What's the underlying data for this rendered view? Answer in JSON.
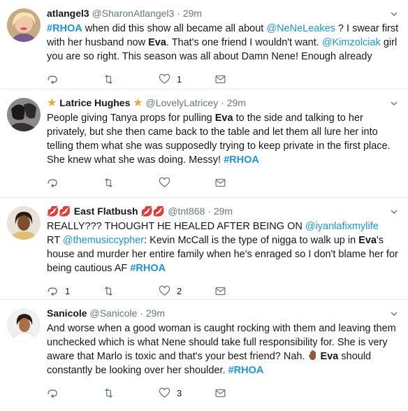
{
  "tweets": [
    {
      "name": "atlangel3",
      "handle": "@SharonAtlangel3",
      "time": "29m",
      "text": [
        {
          "t": "hash",
          "v": "#RHOA"
        },
        {
          "t": "txt",
          "v": " when did this show all became all about "
        },
        {
          "t": "link",
          "v": "@NeNeLeakes"
        },
        {
          "t": "txt",
          "v": " ? I swear first with her husband now "
        },
        {
          "t": "bold",
          "v": "Eva"
        },
        {
          "t": "txt",
          "v": ". That's one friend I wouldn't want. "
        },
        {
          "t": "link",
          "v": "@Kimzolciak"
        },
        {
          "t": "txt",
          "v": " girl you are so right. This season was all about Damn Nene! Enough already"
        }
      ],
      "reply_count": "",
      "retweet_count": "",
      "like_count": "1"
    },
    {
      "name": "Latrice Hughes",
      "handle": "@LovelyLatricey",
      "time": "29m",
      "text": [
        {
          "t": "txt",
          "v": "People giving Tanya props for pulling "
        },
        {
          "t": "bold",
          "v": "Eva"
        },
        {
          "t": "txt",
          "v": " to the side and talking to her privately, but she then came back to the table and let them all lure her into telling them what she was supposedly trying to keep private in the first place.   She knew what she was doing.  Messy! "
        },
        {
          "t": "hash",
          "v": "#RHOA"
        }
      ],
      "reply_count": "",
      "retweet_count": "",
      "like_count": ""
    },
    {
      "name": "East Flatbush",
      "handle": "@tnt868",
      "time": "29m",
      "text": [
        {
          "t": "txt",
          "v": "REALLY??? THOUGHT HE HEALED AFTER BEING ON "
        },
        {
          "t": "link",
          "v": "@iyanlafixmylife"
        },
        {
          "t": "br",
          "v": ""
        },
        {
          "t": "txt",
          "v": "RT "
        },
        {
          "t": "link",
          "v": "@themusiccypher"
        },
        {
          "t": "txt",
          "v": ": Kevin McCall is the type of nigga to walk up in "
        },
        {
          "t": "bold",
          "v": "Eva"
        },
        {
          "t": "txt",
          "v": "'s house and murder her entire family when he's enraged so I don't blame her for being cautious AF "
        },
        {
          "t": "hash",
          "v": "#RHOA"
        }
      ],
      "reply_count": "1",
      "retweet_count": "",
      "like_count": "2"
    },
    {
      "name": "Sanicole",
      "handle": "@Sanicole",
      "time": "29m",
      "text": [
        {
          "t": "txt",
          "v": "And worse when a good woman is caught rocking with them and leaving them unchecked which is what Nene should take full responsibility for. She is very aware that Marlo is toxic and that's your best friend? Nah. "
        },
        {
          "t": "hand",
          "v": ""
        },
        {
          "t": "bold",
          "v": "Eva"
        },
        {
          "t": "txt",
          "v": " should constantly be looking over her shoulder. "
        },
        {
          "t": "hash",
          "v": "#RHOA"
        }
      ],
      "reply_count": "",
      "retweet_count": "",
      "like_count": "3"
    }
  ],
  "icons": [
    "reply-icon",
    "retweet-icon",
    "like-icon",
    "dm-icon",
    "caret-down-icon"
  ],
  "colors": {
    "link": "#1b95e0",
    "muted": "#657786",
    "text": "#14171a",
    "divider": "#e6ecf0",
    "star": "#f5a623",
    "lips": "#e0245e"
  }
}
